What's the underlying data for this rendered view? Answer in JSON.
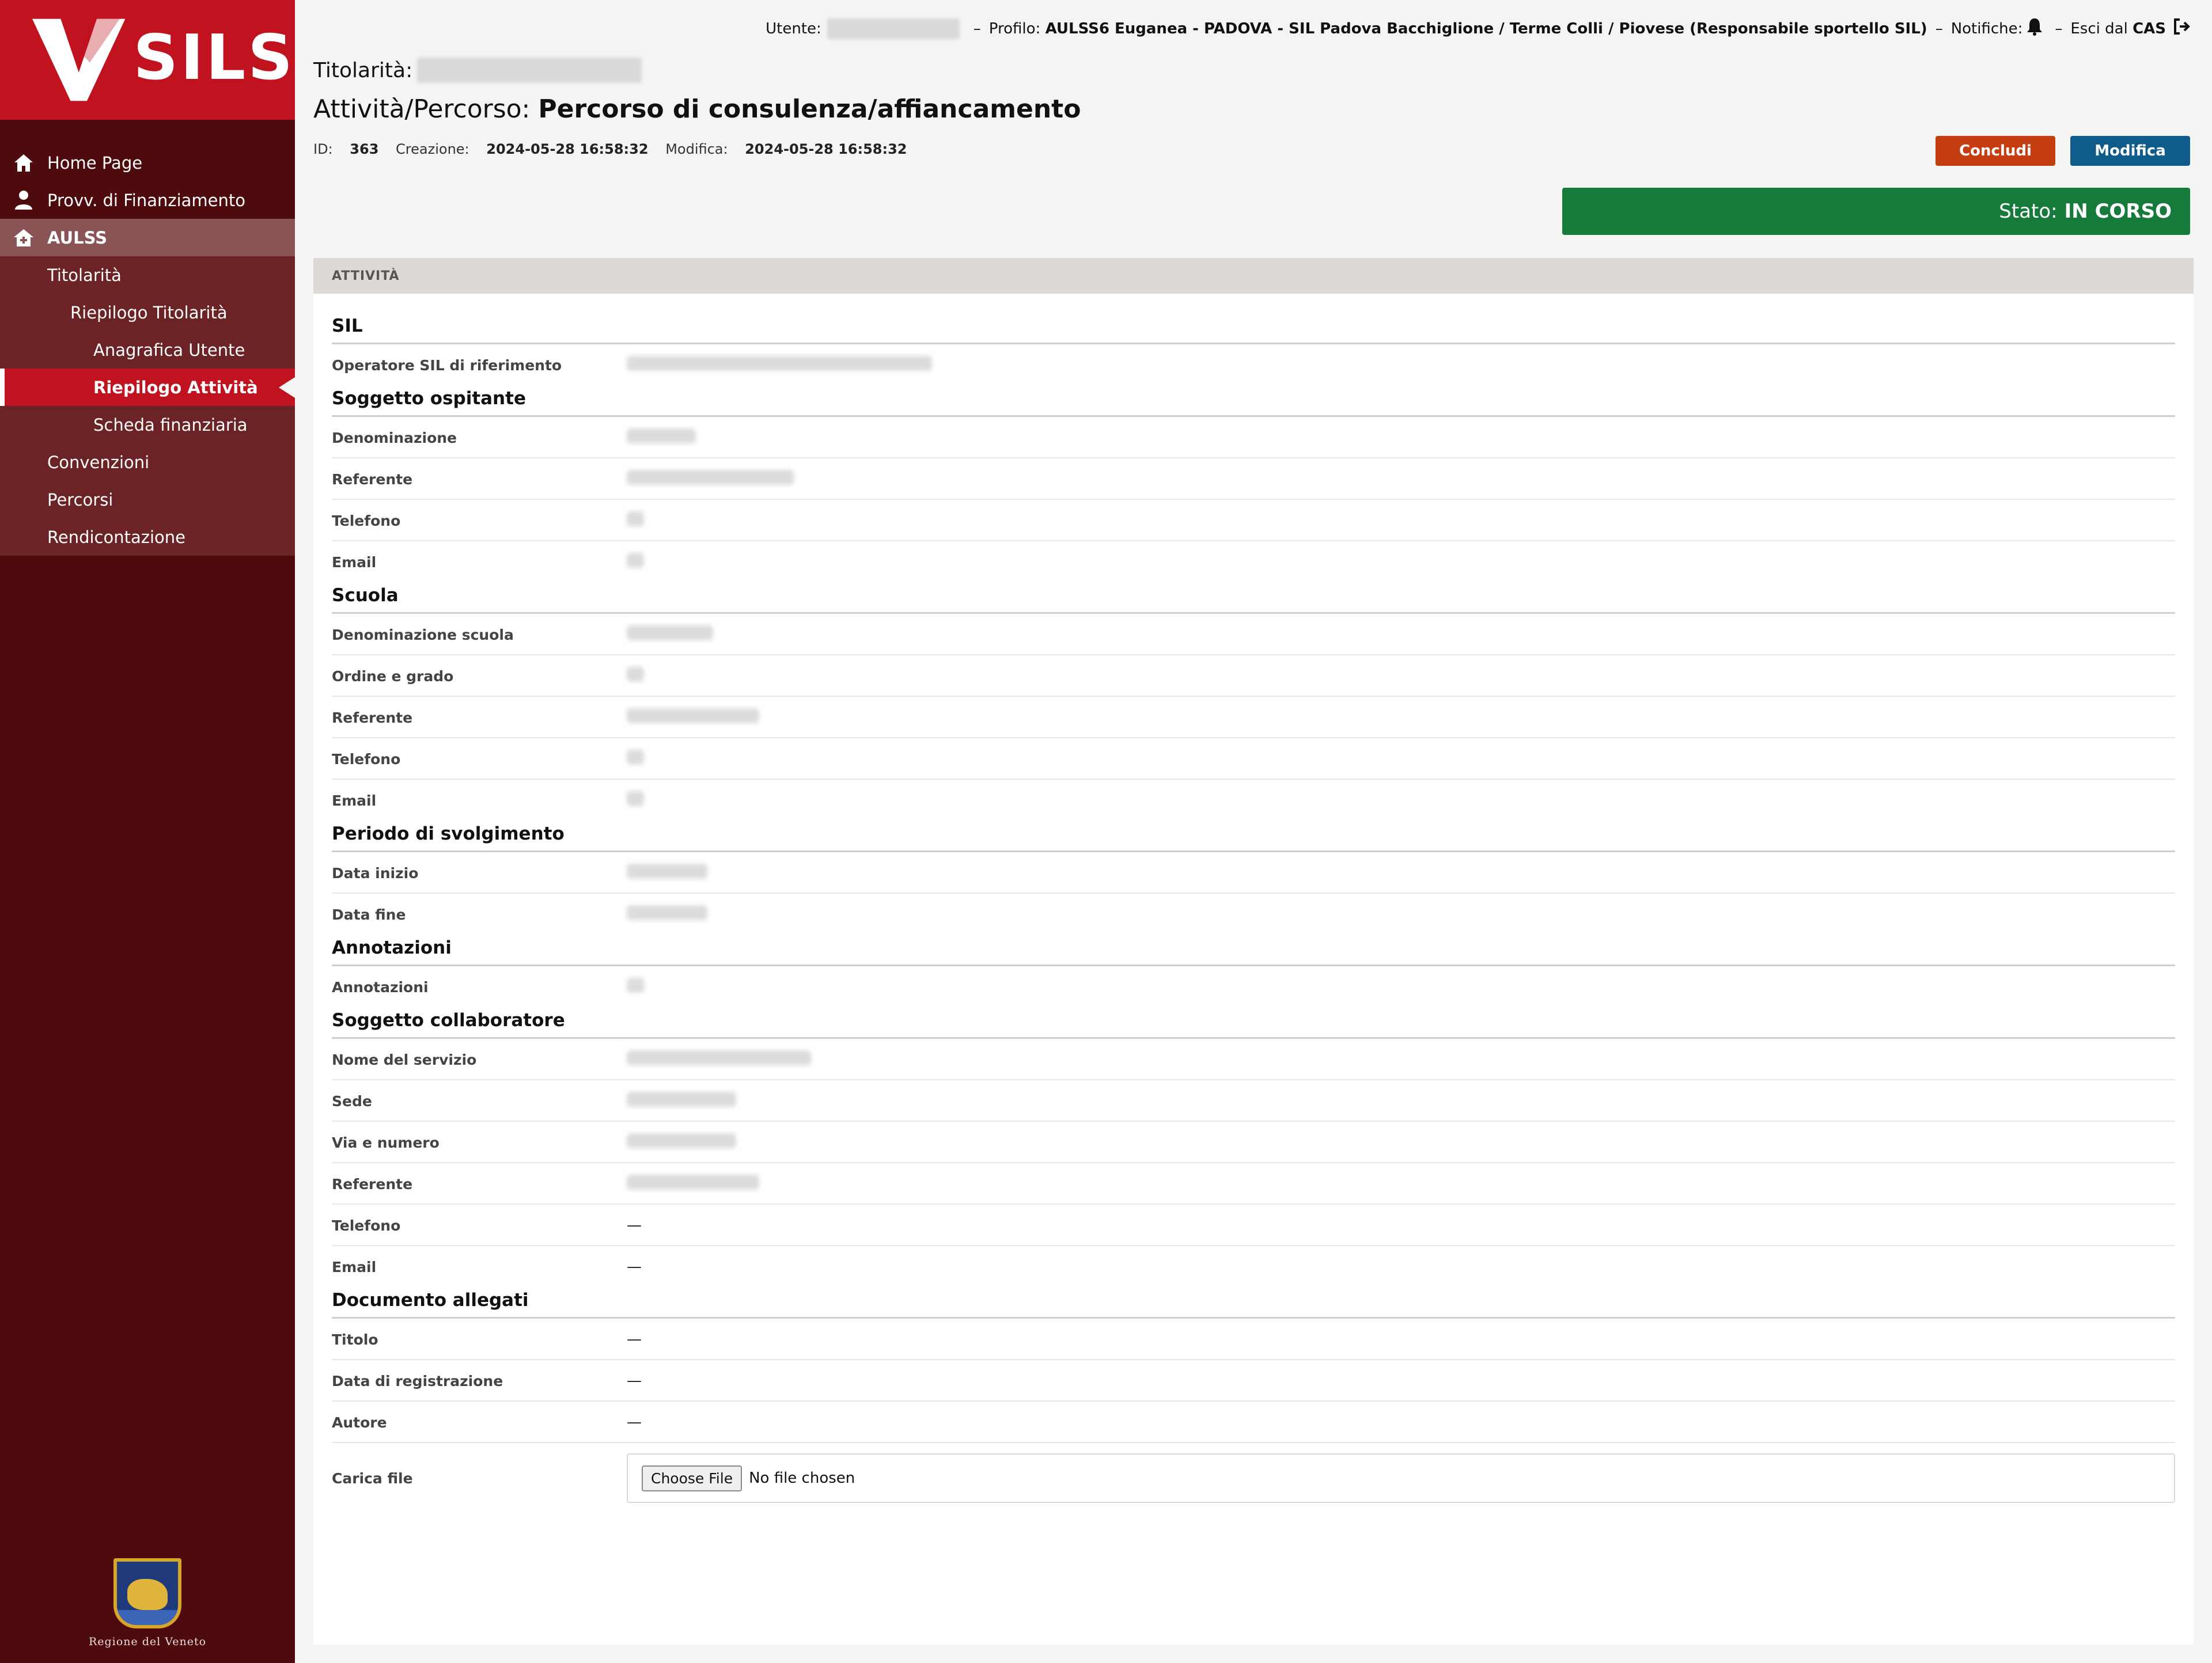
{
  "brand": {
    "name": "SILS"
  },
  "sidebar": {
    "items": [
      {
        "label": "Home Page",
        "icon": "home-icon"
      },
      {
        "label": "Provv. di Finanziamento",
        "icon": "user-icon"
      }
    ],
    "section": {
      "label": "AULSS",
      "icon": "home-plus-icon"
    },
    "sub": [
      {
        "label": "Titolarità"
      },
      {
        "label": "Riepilogo Titolarità"
      },
      {
        "label": "Anagrafica Utente"
      },
      {
        "label": "Riepilogo Attività"
      },
      {
        "label": "Scheda finanziaria"
      },
      {
        "label": "Convenzioni"
      },
      {
        "label": "Percorsi"
      },
      {
        "label": "Rendicontazione"
      }
    ],
    "region": "Regione del Veneto"
  },
  "topbar": {
    "utente_label": "Utente:",
    "profilo_label": "Profilo:",
    "profilo_value": "AULSS6 Euganea - PADOVA - SIL Padova Bacchiglione / Terme Colli / Piovese (Responsabile sportello SIL)",
    "notifiche_label": "Notifiche:",
    "esci_label": "Esci dal",
    "esci_value": "CAS",
    "separator": "–"
  },
  "header": {
    "titolarita_label": "Titolarità:",
    "title_prefix": "Attività/Percorso:",
    "title_value": "Percorso di consulenza/affiancamento",
    "id_label": "ID:",
    "id_value": "363",
    "creazione_label": "Creazione:",
    "creazione_value": "2024-05-28 16:58:32",
    "modifica_label": "Modifica:",
    "modifica_value": "2024-05-28 16:58:32"
  },
  "actions": {
    "concludi": "Concludi",
    "modifica": "Modifica"
  },
  "status": {
    "label": "Stato:",
    "value": "IN CORSO",
    "color": "#167a3a"
  },
  "panel": {
    "title": "ATTIVITÀ",
    "sil": {
      "title": "SIL",
      "operatore_label": "Operatore SIL di riferimento"
    },
    "ospitante": {
      "title": "Soggetto ospitante",
      "denominazione": "Denominazione",
      "referente": "Referente",
      "telefono": "Telefono",
      "email": "Email"
    },
    "scuola": {
      "title": "Scuola",
      "denominazione": "Denominazione scuola",
      "ordine": "Ordine e grado",
      "referente": "Referente",
      "telefono": "Telefono",
      "email": "Email"
    },
    "periodo": {
      "title": "Periodo di svolgimento",
      "inizio": "Data inizio",
      "fine": "Data fine"
    },
    "annotazioni": {
      "title": "Annotazioni",
      "label": "Annotazioni"
    },
    "collaboratore": {
      "title": "Soggetto collaboratore",
      "nome": "Nome del servizio",
      "sede": "Sede",
      "via": "Via e numero",
      "referente": "Referente",
      "telefono": "Telefono",
      "telefono_value": "—",
      "email": "Email",
      "email_value": "—"
    },
    "documenti": {
      "title": "Documento allegati",
      "titolo": "Titolo",
      "titolo_value": "—",
      "data": "Data di registrazione",
      "data_value": "—",
      "autore": "Autore",
      "autore_value": "—",
      "carica": "Carica file",
      "choose_file": "Choose File",
      "no_file": "No file chosen"
    }
  }
}
